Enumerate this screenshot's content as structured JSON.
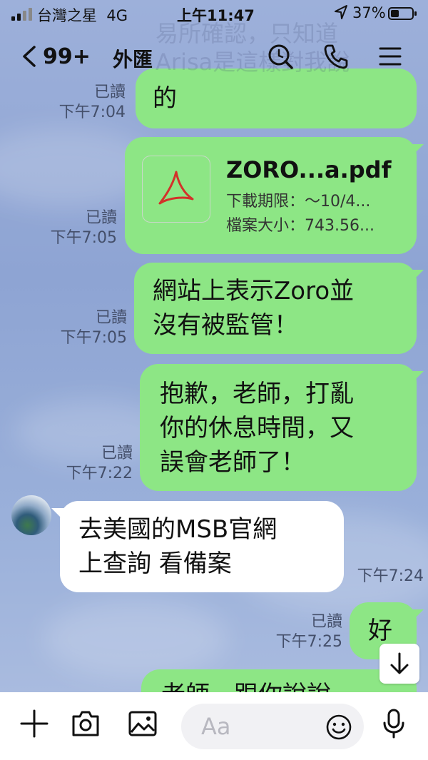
{
  "status_bar": {
    "carrier": "台灣之星",
    "network": "4G",
    "time": "上午11:47",
    "battery": "37%"
  },
  "header": {
    "unread_count": "99+",
    "title": "外匯",
    "faded_text_1": "易所確認，只知道",
    "faded_text_2": "Arisa是這樣對我說"
  },
  "messages": [
    {
      "kind": "sent",
      "text": "的",
      "read": "已讀",
      "time": "下午7:04"
    },
    {
      "kind": "file",
      "file_name": "ZORO...a.pdf",
      "expiry": "下載期限：～10/4...",
      "size": "檔案大小：743.56...",
      "read": "已讀",
      "time": "下午7:05"
    },
    {
      "kind": "sent",
      "line1": "網站上表示Zoro並",
      "line2": "沒有被監管！",
      "read": "已讀",
      "time": "下午7:05"
    },
    {
      "kind": "sent",
      "line1": "抱歉，老師，打亂",
      "line2": "你的休息時間，又",
      "line3": "誤會老師了！",
      "read": "已讀",
      "time": "下午7:22"
    },
    {
      "kind": "received",
      "line1": "去美國的MSB官網",
      "line2": "上查詢 看備案",
      "time": "下午7:24"
    },
    {
      "kind": "sent",
      "text": "好",
      "read": "已讀",
      "time": "下午7:25"
    },
    {
      "kind": "sent-partial",
      "text": "老師，跟你說說"
    }
  ],
  "input": {
    "placeholder": "Aa"
  },
  "colors": {
    "sent_bubble": "#8de685",
    "received_bubble": "#ffffff",
    "chat_background": "#9db0da"
  }
}
